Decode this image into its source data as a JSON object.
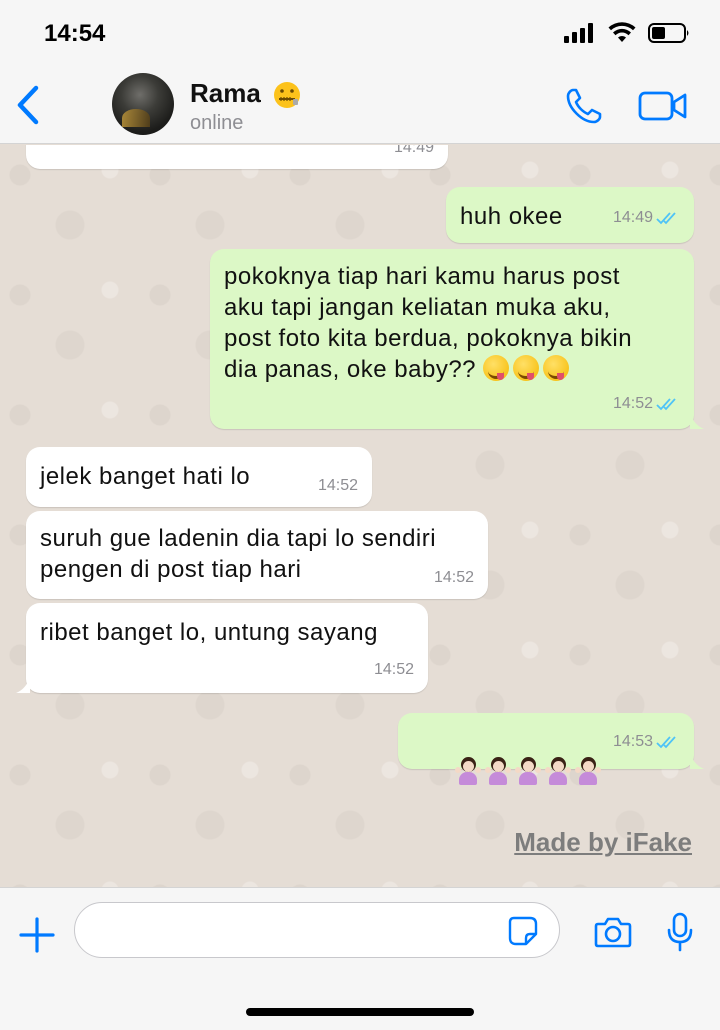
{
  "status_bar": {
    "time": "14:54"
  },
  "header": {
    "contact_name": "Rama",
    "contact_status": "online",
    "name_emoji_icon": "zipper-mouth-face-icon"
  },
  "messages": [
    {
      "direction": "in",
      "text": "",
      "time": "14:49",
      "partial": true
    },
    {
      "direction": "out",
      "text": "huh okee",
      "time": "14:49",
      "read": true
    },
    {
      "direction": "out",
      "text": "pokoknya tiap hari kamu harus post\naku tapi jangan keliatan muka aku,\npost foto kita berdua, pokoknya bikin\ndia panas, oke baby??",
      "emoji": [
        "face-savoring-food",
        "face-savoring-food",
        "face-savoring-food"
      ],
      "time": "14:52",
      "read": true
    },
    {
      "direction": "in",
      "text": "jelek banget hati lo",
      "time": "14:52"
    },
    {
      "direction": "in",
      "text": "suruh gue ladenin dia tapi lo sendiri\npengen di post tiap hari",
      "time": "14:52"
    },
    {
      "direction": "in",
      "text": "ribet banget lo, untung sayang",
      "time": "14:52"
    },
    {
      "direction": "out",
      "text": "",
      "emoji": [
        "person-shrugging",
        "person-shrugging",
        "person-shrugging",
        "person-shrugging",
        "person-shrugging"
      ],
      "time": "14:53",
      "read": true
    }
  ],
  "watermark": "Made by iFake",
  "input": {
    "placeholder": "",
    "value": ""
  },
  "colors": {
    "accent": "#007aff",
    "outgoing_bubble": "#dcf8c6",
    "incoming_bubble": "#ffffff",
    "read_ticks": "#4fc3f7",
    "chat_background": "#e5ddd5"
  }
}
